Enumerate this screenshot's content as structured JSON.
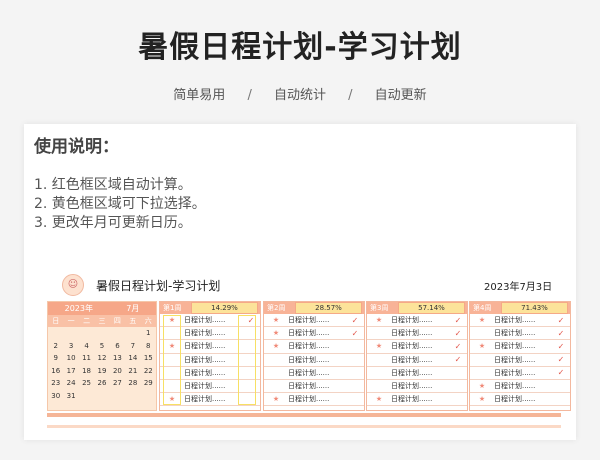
{
  "title": "暑假日程计划-学习计划",
  "subnav": [
    "简单易用",
    "自动统计",
    "自动更新"
  ],
  "subnav_sep": "/",
  "usage": {
    "heading": "使用说明：",
    "items": [
      "1. 红色框区域自动计算。",
      "2. 黄色框区域可下拉选择。",
      "3. 更改年月可更新日历。"
    ]
  },
  "sheet": {
    "title": "暑假日程计划-学习计划",
    "date": "2023年7月3日",
    "calendar": {
      "year": "2023年",
      "month": "7月",
      "weekdays": [
        "日",
        "一",
        "二",
        "三",
        "四",
        "五",
        "六"
      ],
      "days": [
        "",
        "",
        "",
        "",
        "",
        "",
        "1",
        "2",
        "3",
        "4",
        "5",
        "6",
        "7",
        "8",
        "9",
        "10",
        "11",
        "12",
        "13",
        "14",
        "15",
        "16",
        "17",
        "18",
        "19",
        "20",
        "21",
        "22",
        "23",
        "24",
        "25",
        "26",
        "27",
        "28",
        "29",
        "30",
        "31"
      ]
    },
    "weeks": [
      {
        "label": "第1周",
        "percent": "14.29%",
        "rows": [
          {
            "mark": "★",
            "plan": "日程计划......",
            "check": "✓"
          },
          {
            "mark": "",
            "plan": "日程计划......",
            "check": ""
          },
          {
            "mark": "★",
            "plan": "日程计划......",
            "check": ""
          },
          {
            "mark": "",
            "plan": "日程计划......",
            "check": ""
          },
          {
            "mark": "",
            "plan": "日程计划......",
            "check": ""
          },
          {
            "mark": "",
            "plan": "日程计划......",
            "check": ""
          },
          {
            "mark": "★",
            "plan": "日程计划......",
            "check": ""
          }
        ]
      },
      {
        "label": "第2周",
        "percent": "28.57%",
        "rows": [
          {
            "mark": "★",
            "plan": "日程计划......",
            "check": "✓"
          },
          {
            "mark": "★",
            "plan": "日程计划......",
            "check": "✓"
          },
          {
            "mark": "★",
            "plan": "日程计划......",
            "check": ""
          },
          {
            "mark": "",
            "plan": "日程计划......",
            "check": ""
          },
          {
            "mark": "",
            "plan": "日程计划......",
            "check": ""
          },
          {
            "mark": "",
            "plan": "日程计划......",
            "check": ""
          },
          {
            "mark": "★",
            "plan": "日程计划......",
            "check": ""
          }
        ]
      },
      {
        "label": "第3周",
        "percent": "57.14%",
        "rows": [
          {
            "mark": "★",
            "plan": "日程计划......",
            "check": "✓"
          },
          {
            "mark": "",
            "plan": "日程计划......",
            "check": "✓"
          },
          {
            "mark": "★",
            "plan": "日程计划......",
            "check": "✓"
          },
          {
            "mark": "",
            "plan": "日程计划......",
            "check": "✓"
          },
          {
            "mark": "",
            "plan": "日程计划......",
            "check": ""
          },
          {
            "mark": "",
            "plan": "日程计划......",
            "check": ""
          },
          {
            "mark": "★",
            "plan": "日程计划......",
            "check": ""
          }
        ]
      },
      {
        "label": "第4周",
        "percent": "71.43%",
        "rows": [
          {
            "mark": "★",
            "plan": "日程计划......",
            "check": "✓"
          },
          {
            "mark": "",
            "plan": "日程计划......",
            "check": "✓"
          },
          {
            "mark": "★",
            "plan": "日程计划......",
            "check": "✓"
          },
          {
            "mark": "",
            "plan": "日程计划......",
            "check": "✓"
          },
          {
            "mark": "",
            "plan": "日程计划......",
            "check": "✓"
          },
          {
            "mark": "★",
            "plan": "日程计划......",
            "check": ""
          },
          {
            "mark": "★",
            "plan": "日程计划......",
            "check": ""
          }
        ]
      }
    ]
  },
  "colors": {
    "header_band": "#f6a788",
    "calendar_bg": "#fde9d6",
    "highlight": "#fce39a",
    "check": "#e2554a"
  }
}
